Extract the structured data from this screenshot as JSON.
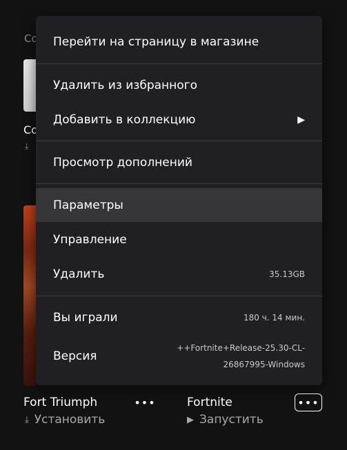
{
  "background": {
    "frag_top": "Co",
    "frag_mid": "Co"
  },
  "cards": [
    {
      "title": "Fort Triumph",
      "action": "Установить",
      "action_icon": "download-icon"
    },
    {
      "title": "Fortnite",
      "action": "Запустить",
      "action_icon": "play-icon"
    }
  ],
  "more_glyph": "•••",
  "menu": {
    "store_page": "Перейти на страницу в магазине",
    "remove_favorite": "Удалить из избранного",
    "add_collection": "Добавить в коллекцию",
    "view_addons": "Просмотр дополнений",
    "settings": "Параметры",
    "manage": "Управление",
    "uninstall": "Удалить",
    "uninstall_size": "35.13GB",
    "played_label": "Вы играли",
    "played_value": "180 ч. 14 мин.",
    "version_label": "Версия",
    "version_line1": "++Fortnite+Release-25.30-CL-",
    "version_line2": "26867995-Windows"
  }
}
